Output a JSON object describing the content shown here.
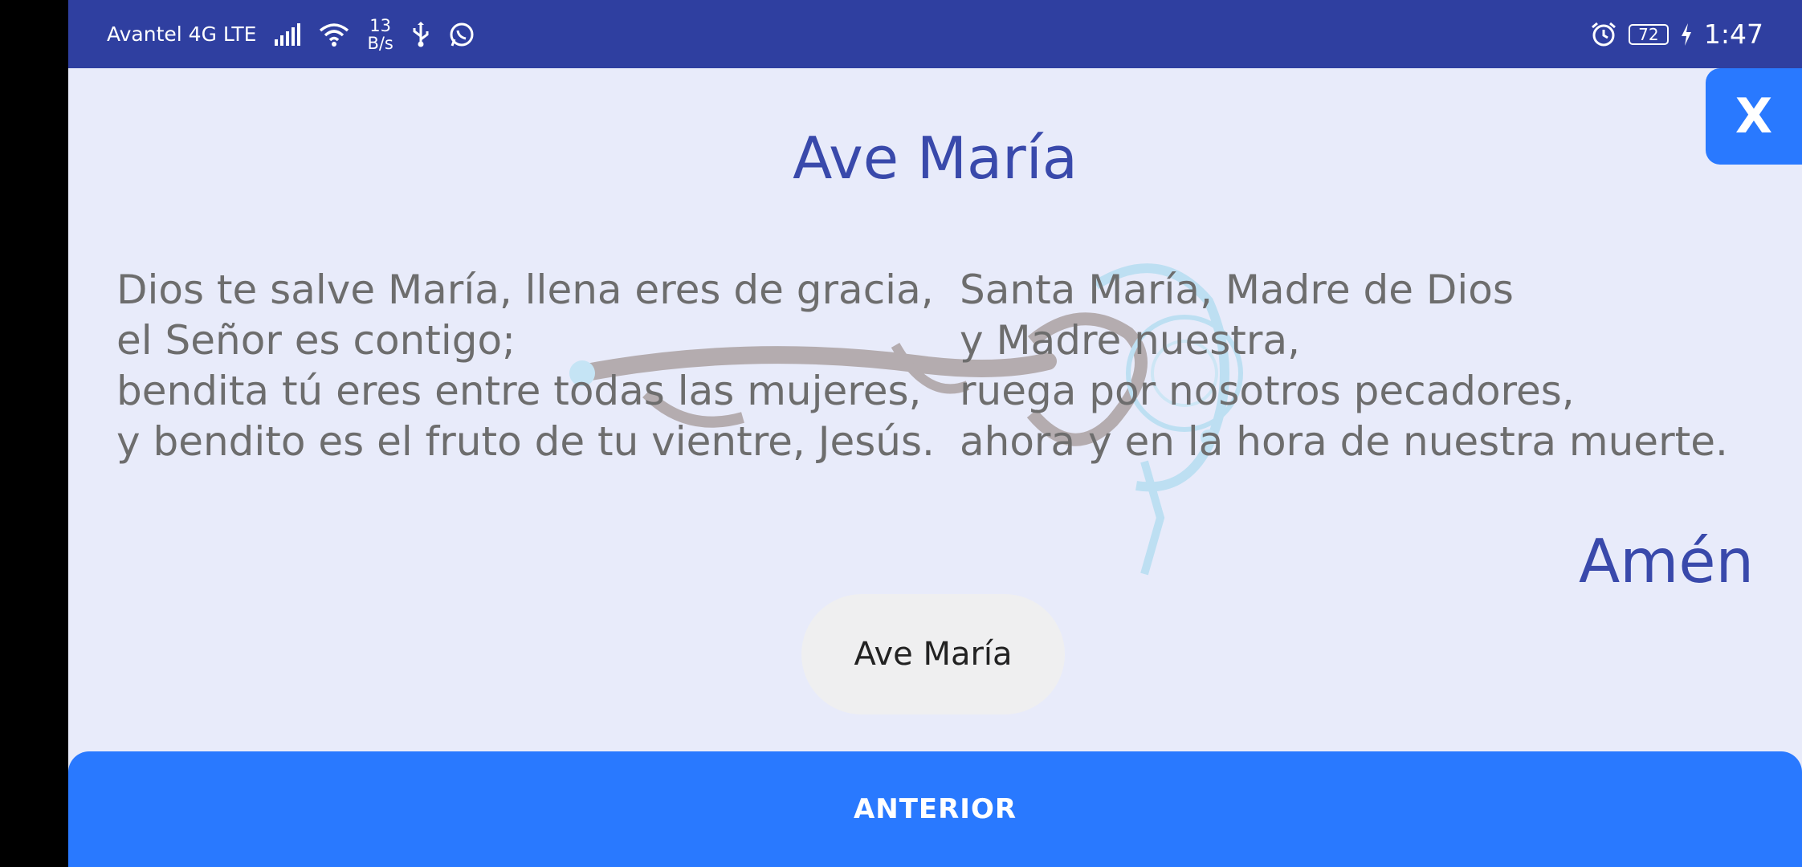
{
  "status_bar": {
    "carrier": "Avantel 4G LTE",
    "net_speed_value": "13",
    "net_speed_unit": "B/s",
    "battery": "72",
    "time": "1:47",
    "icons": [
      "signal-icon",
      "wifi-icon",
      "usb-icon",
      "whatsapp-icon",
      "alarm-icon",
      "battery-icon",
      "charging-icon"
    ]
  },
  "prayer": {
    "title": "Ave María",
    "left_lines": [
      "Dios te salve María, llena eres de gracia,",
      "el Señor es contigo;",
      "bendita tú eres entre todas las mujeres,",
      "y bendito es el fruto de tu vientre, Jesús."
    ],
    "right_lines": [
      "Santa María, Madre de Dios",
      "y Madre nuestra,",
      "ruega por nosotros pecadores,",
      "ahora y en la hora de nuestra muerte."
    ],
    "amen": "Amén"
  },
  "buttons": {
    "close": "X",
    "current": "Ave María",
    "previous": "ANTERIOR"
  },
  "colors": {
    "status_bar": "#2f3fa0",
    "background": "#e8ebfa",
    "accent": "#2979ff",
    "title": "#3949ab"
  }
}
